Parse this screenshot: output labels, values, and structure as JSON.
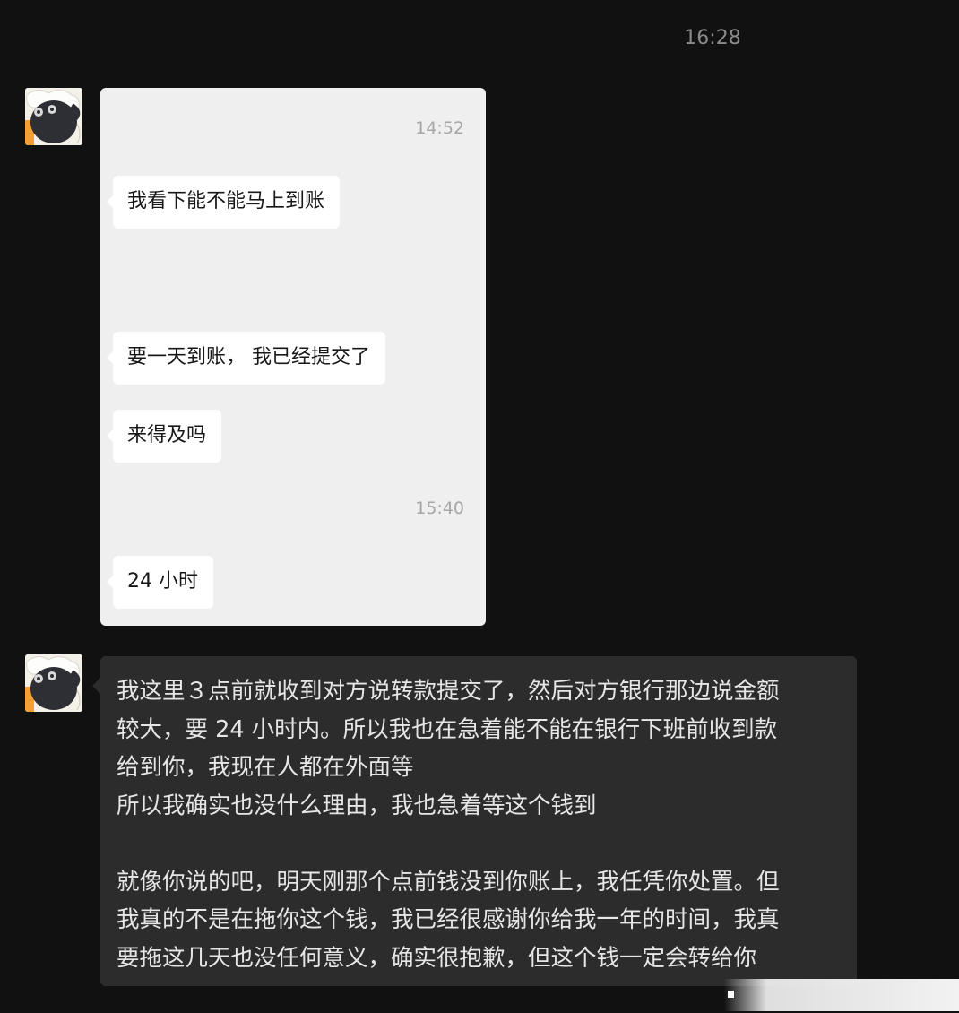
{
  "chat": {
    "divider_time": "16:28",
    "quoted_card": {
      "timestamp_1": "14:52",
      "msg_1": "我看下能不能马上到账",
      "msg_2": "要一天到账， 我已经提交了",
      "msg_3": "来得及吗",
      "timestamp_2": "15:40",
      "msg_4": "24 小时"
    },
    "reply": {
      "lines": [
        "我这里３点前就收到对方说转款提交了，然后对方银行那边说金额",
        "较大，要 24 小时内。所以我也在急着能不能在银行下班前收到款",
        "给到你，我现在人都在外面等",
        "所以我确实也没什么理由，我也急着等这个钱到",
        "",
        "就像你说的吧，明天刚那个点前钱没到你账上，我任凭你处置。但",
        "我真的不是在拖你这个钱，我已经很感谢你给我一年的时间，我真",
        "要拖这几天也没任何意义，确实很抱歉，但这个钱一定会转给你"
      ]
    }
  },
  "colors": {
    "background": "#111111",
    "quoted_card_bg": "#efefef",
    "reply_bubble_bg": "#2c2c2c",
    "reply_text": "#e6e6e6",
    "timestamp": "#8a8a8a",
    "avatar_accent": "#f2a033"
  },
  "icons": {
    "avatar": "cartoon-sheep-avatar"
  }
}
